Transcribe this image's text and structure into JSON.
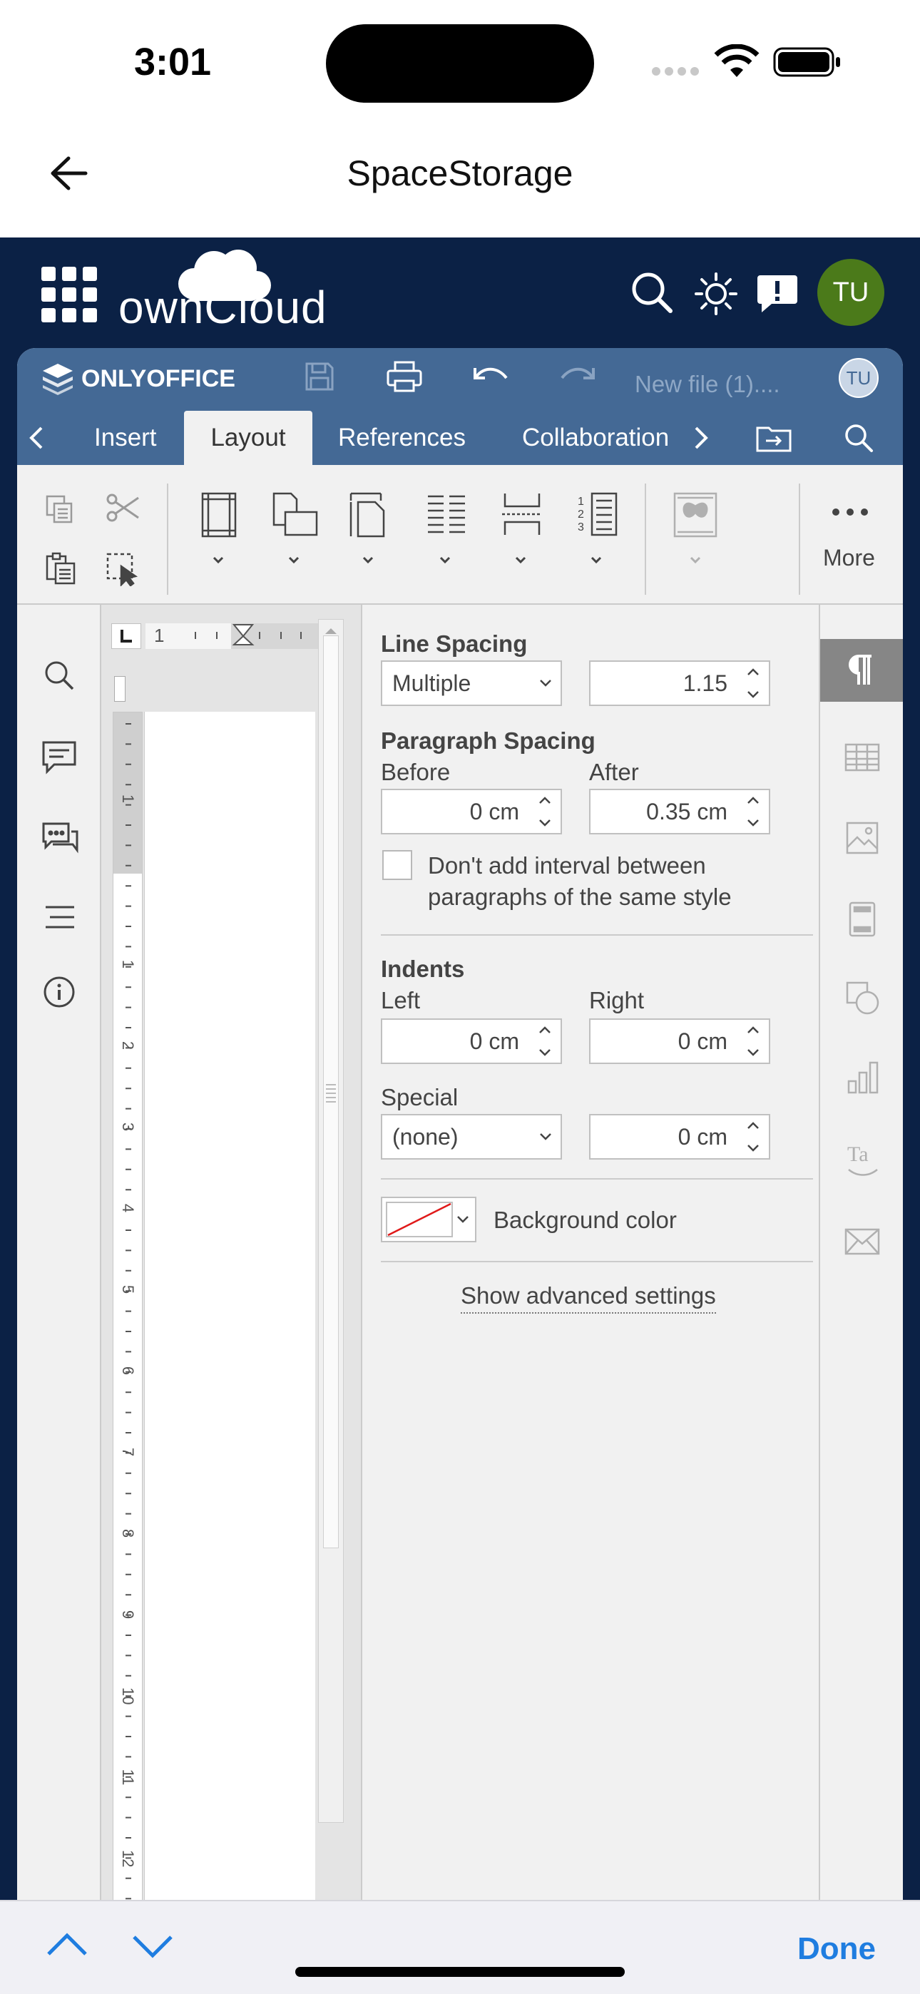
{
  "status": {
    "time": "3:01"
  },
  "nav": {
    "title": "SpaceStorage"
  },
  "owncloud": {
    "logo_text": "ownCloud",
    "avatar": "TU"
  },
  "editor": {
    "brand": "ONLYOFFICE",
    "file_name": "New file (1)....",
    "user_badge": "TU",
    "tabs": [
      "Insert",
      "Layout",
      "References",
      "Collaboration"
    ],
    "more_label": "More"
  },
  "ruler": {
    "h_tick": "1",
    "v_ticks": [
      "1",
      "1",
      "2",
      "3",
      "4",
      "5",
      "6",
      "7",
      "8",
      "9",
      "10",
      "11",
      "12"
    ]
  },
  "paragraph": {
    "line_spacing_title": "Line Spacing",
    "line_spacing_type": "Multiple",
    "line_spacing_value": "1.15",
    "para_spacing_title": "Paragraph Spacing",
    "before_label": "Before",
    "after_label": "After",
    "before_value": "0 cm",
    "after_value": "0.35 cm",
    "dont_add_interval": "Don't add interval between",
    "dont_add_interval_2": "paragraphs of the same style",
    "indents_title": "Indents",
    "left_label": "Left",
    "right_label": "Right",
    "left_value": "0 cm",
    "right_value": "0 cm",
    "special_label": "Special",
    "special_type": "(none)",
    "special_value": "0 cm",
    "background_color_label": "Background color",
    "advanced_link": "Show advanced settings"
  },
  "bottom": {
    "done": "Done"
  },
  "colors": {
    "oo_header": "#446995",
    "oc_bg": "#0b2145",
    "accent": "#1f7de0",
    "avatar": "#4b7a1a"
  }
}
